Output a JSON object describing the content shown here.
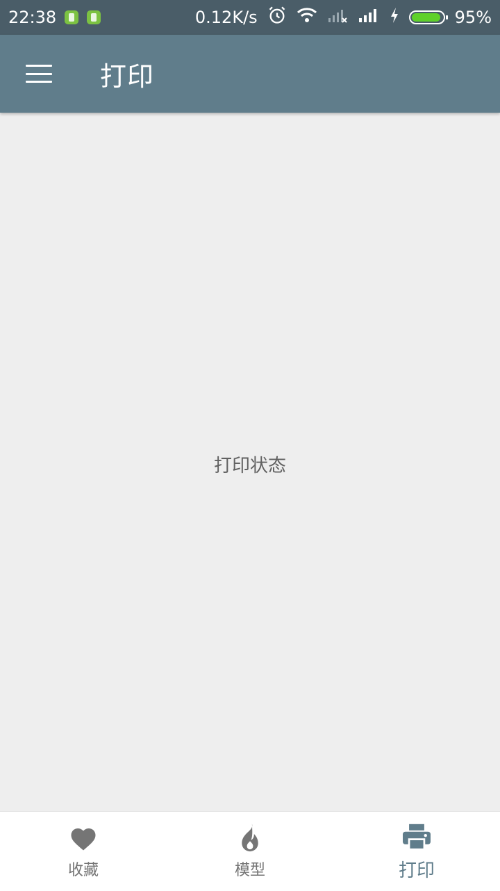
{
  "status_bar": {
    "time": "22:38",
    "net_speed": "0.12K/s",
    "battery_percent": "95%",
    "battery_level": 0.95
  },
  "app_bar": {
    "title": "打印"
  },
  "main": {
    "status_text": "打印状态"
  },
  "bottom_nav": {
    "active_index": 2,
    "items": [
      {
        "label": "收藏",
        "icon": "heart-icon"
      },
      {
        "label": "模型",
        "icon": "flame-icon"
      },
      {
        "label": "打印",
        "icon": "printer-icon"
      }
    ]
  },
  "colors": {
    "status_bar": "#4a5d68",
    "app_bar": "#607d8b",
    "background": "#eeeeee",
    "nav_inactive": "#757575",
    "nav_active": "#607d8b"
  }
}
